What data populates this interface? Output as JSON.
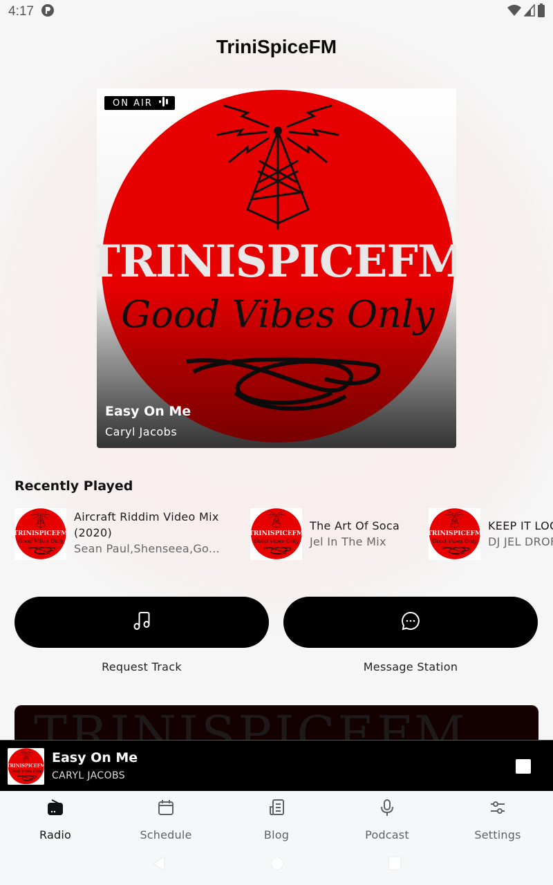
{
  "status_bar": {
    "time": "4:17",
    "icons": [
      "app-notification-icon",
      "wifi-icon",
      "cell-signal-icon",
      "battery-icon"
    ]
  },
  "header": {
    "title": "TriniSpiceFM"
  },
  "now_playing": {
    "badge": "ON AIR",
    "badge_icon": "live-waveform-icon",
    "title": "Easy On Me",
    "artist": "Caryl Jacobs",
    "artwork": {
      "brand_text": "TRINISPICEFM",
      "tagline": "Good Vibes Only",
      "colors": {
        "circle": "#e60000",
        "lettering": "#e8e8e8",
        "ink": "#111111"
      }
    }
  },
  "recently_played": {
    "title": "Recently Played",
    "items": [
      {
        "title": "Aircraft Riddim Video Mix",
        "title_line2": "(2020)",
        "artist": "Sean Paul,Shenseea,Go..."
      },
      {
        "title": "The Art Of Soca",
        "title_line2": "",
        "artist": "Jel In The Mix"
      },
      {
        "title": "KEEP IT LOC",
        "title_line2": "",
        "artist": "DJ JEL DROF"
      }
    ]
  },
  "actions": [
    {
      "label": "Request Track",
      "icon": "music-note-icon"
    },
    {
      "label": "Message Station",
      "icon": "chat-bubble-icon"
    }
  ],
  "banner": {
    "text": "TRINISPICEFM"
  },
  "mini_player": {
    "title": "Easy On Me",
    "artist": "CARYL JACOBS",
    "control": "stop"
  },
  "bottom_nav": {
    "active": "Radio",
    "items": [
      {
        "label": "Radio",
        "icon": "radio-icon"
      },
      {
        "label": "Schedule",
        "icon": "calendar-icon"
      },
      {
        "label": "Blog",
        "icon": "newspaper-icon"
      },
      {
        "label": "Podcast",
        "icon": "microphone-icon"
      },
      {
        "label": "Settings",
        "icon": "sliders-icon"
      }
    ]
  },
  "colors": {
    "background": "#f6f6f6",
    "accent": "#000000",
    "brand_red": "#e60000",
    "nav_inactive": "#5d6166"
  }
}
